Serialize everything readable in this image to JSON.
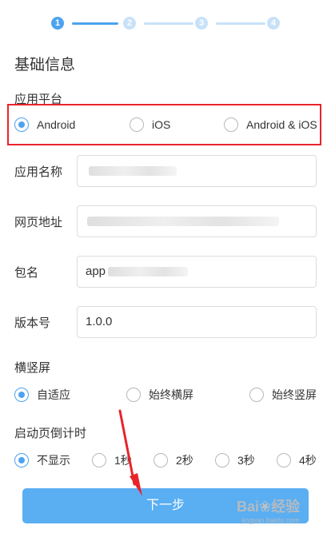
{
  "stepper": {
    "steps": [
      "1",
      "2",
      "3",
      "4"
    ],
    "current": 1
  },
  "section_title": "基础信息",
  "platform": {
    "label": "应用平台",
    "options": [
      "Android",
      "iOS",
      "Android & iOS"
    ],
    "selected": "Android"
  },
  "fields": {
    "app_name": {
      "label": "应用名称",
      "value": ""
    },
    "web_url": {
      "label": "网页地址",
      "value": ""
    },
    "package": {
      "label": "包名",
      "value": "app"
    },
    "version": {
      "label": "版本号",
      "value": "1.0.0"
    }
  },
  "orientation": {
    "label": "横竖屏",
    "options": [
      "自适应",
      "始终横屏",
      "始终竖屏"
    ],
    "selected": "自适应"
  },
  "splash_countdown": {
    "label": "启动页倒计时",
    "options": [
      "不显示",
      "1秒",
      "2秒",
      "3秒",
      "4秒"
    ],
    "selected": "不显示"
  },
  "next_button": "下一步",
  "watermark": {
    "brand": "Bai",
    "brand2": "经验",
    "url": "jingyan.baidu.com"
  },
  "colors": {
    "accent": "#4da3f0",
    "highlight": "#e8242b",
    "button": "#5aaef2"
  }
}
